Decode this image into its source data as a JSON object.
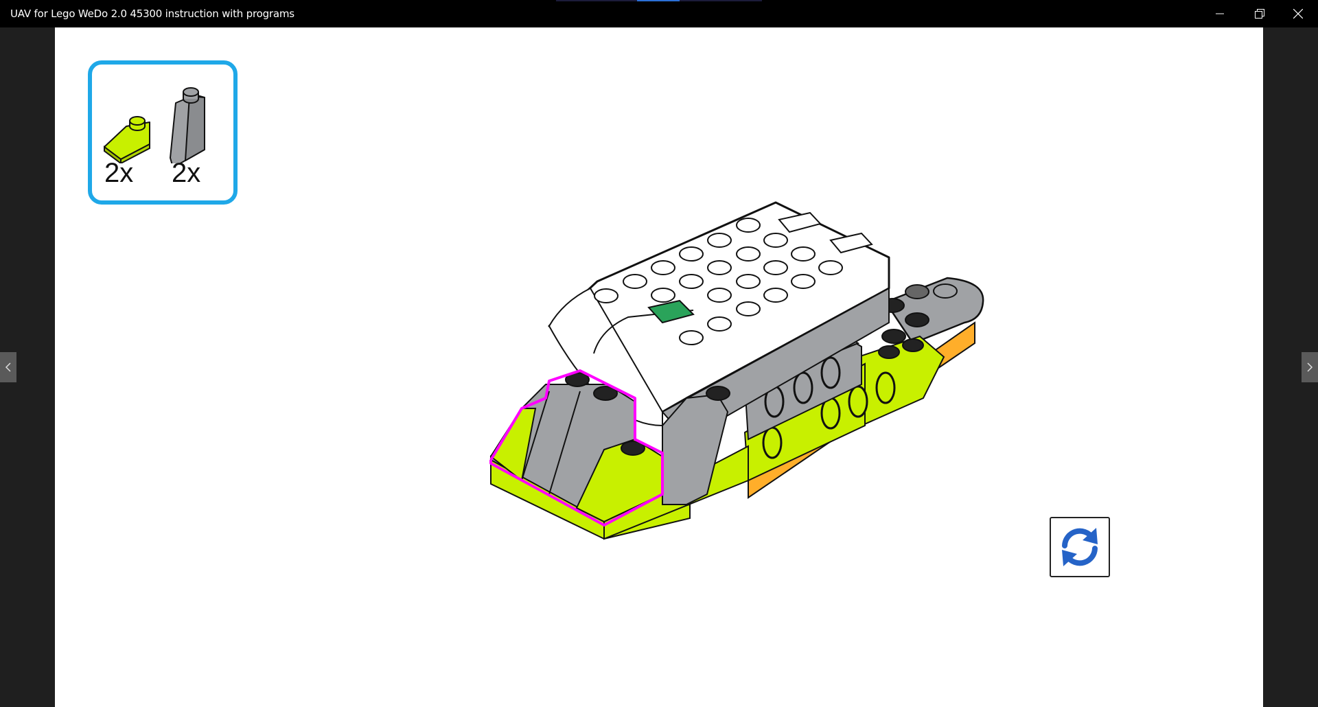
{
  "window": {
    "title": "UAV for Lego WeDo 2.0 45300 instruction with programs",
    "controls": [
      "minimize-icon",
      "restore-icon",
      "close-icon"
    ]
  },
  "parts_list": {
    "accent_color": "#1fa8e8",
    "items": [
      {
        "name": "lime-slope-brick",
        "color": "#c8f000",
        "quantity": "2x"
      },
      {
        "name": "gray-slope-brick",
        "color": "#a0a2a5",
        "quantity": "2x"
      }
    ]
  },
  "model": {
    "highlight_color": "#ff00ff",
    "colors": {
      "white": "#ffffff",
      "gray": "#a0a2a5",
      "lime": "#c8f000",
      "orange": "#ffae2a",
      "green": "#2aa35a"
    }
  },
  "navigation": {
    "prev": "chevron-left-icon",
    "next": "chevron-right-icon"
  },
  "rotate_button": {
    "icon": "rotate-icon",
    "color": "#2563c7"
  }
}
